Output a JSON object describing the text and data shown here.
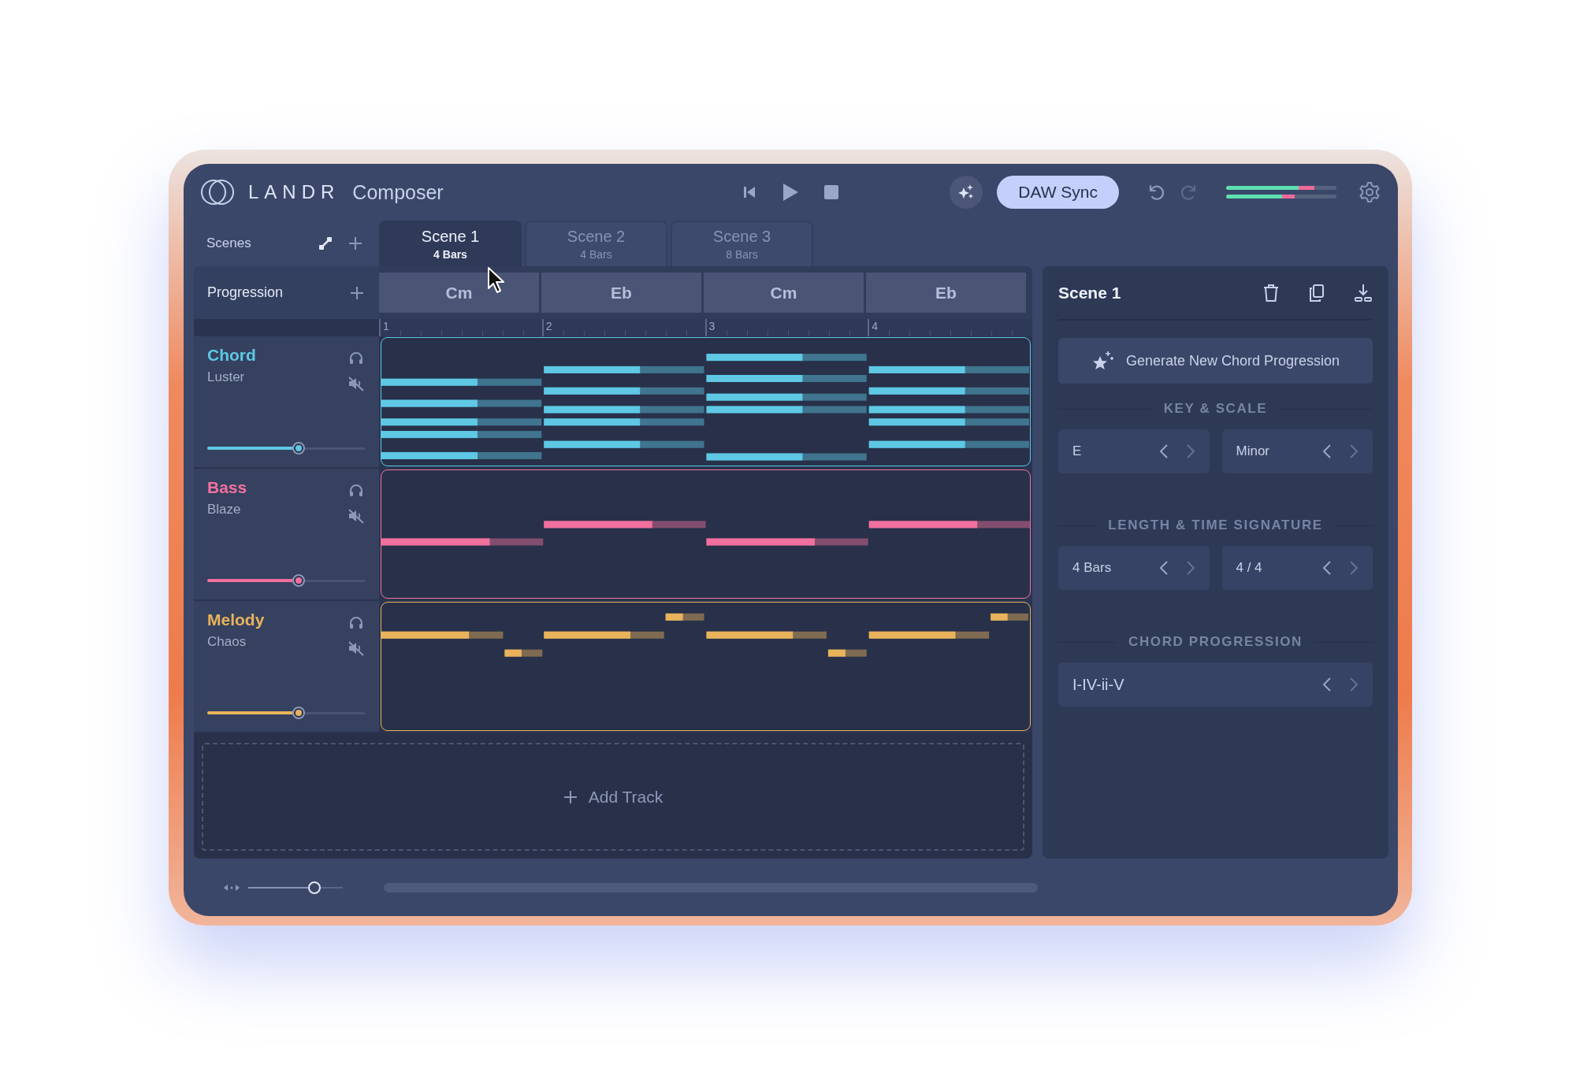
{
  "app": {
    "brand": "LANDR",
    "product": "Composer"
  },
  "toolbar": {
    "sync_button": "DAW Sync",
    "meters": [
      {
        "level": 0.8
      },
      {
        "level": 0.62
      }
    ]
  },
  "scenes": {
    "title": "Scenes",
    "tabs": [
      {
        "label": "Scene 1",
        "length": "4 Bars",
        "selected": true
      },
      {
        "label": "Scene 2",
        "length": "4 Bars",
        "selected": false
      },
      {
        "label": "Scene 3",
        "length": "8 Bars",
        "selected": false
      }
    ]
  },
  "progression": {
    "title": "Progression",
    "chords": [
      "Cm",
      "Eb",
      "Cm",
      "Eb"
    ]
  },
  "ruler": [
    "1",
    "2",
    "3",
    "4"
  ],
  "tracks": [
    {
      "kind": "chord",
      "name": "Chord",
      "instrument": "Luster",
      "color": "#5ec8e5",
      "volume": {
        "level": 0.58
      }
    },
    {
      "kind": "bass",
      "name": "Bass",
      "instrument": "Blaze",
      "color": "#f2709e",
      "volume": {
        "level": 0.58
      }
    },
    {
      "kind": "melody",
      "name": "Melody",
      "instrument": "Chaos",
      "color": "#e9b35c",
      "volume": {
        "level": 0.58
      }
    }
  ],
  "add_track": "Add Track",
  "footer": {
    "zoom": {
      "level": 0.7
    }
  },
  "inspector": {
    "title": "Scene 1",
    "generate_button": "Generate New Chord Progression",
    "sections": [
      {
        "heading": "KEY & SCALE",
        "fields": [
          "E",
          "Minor"
        ]
      },
      {
        "heading": "LENGTH & TIME SIGNATURE",
        "fields": [
          "4 Bars",
          "4 / 4"
        ]
      },
      {
        "heading": "CHORD PROGRESSION",
        "fields": [
          "I-IV-ii-V"
        ]
      }
    ]
  }
}
